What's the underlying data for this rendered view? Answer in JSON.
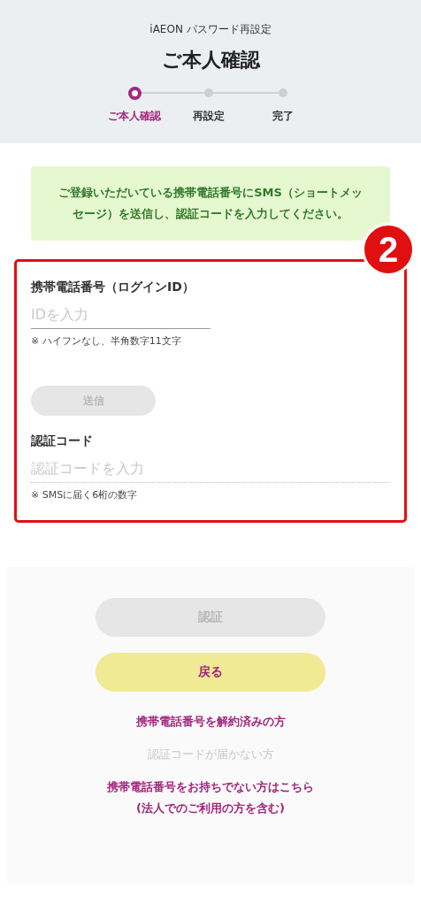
{
  "header": {
    "app_title": "iAEON パスワード再設定",
    "title": "ご本人確認"
  },
  "steps": [
    {
      "label": "ご本人確認",
      "selected": true
    },
    {
      "label": "再設定",
      "selected": false
    },
    {
      "label": "完了",
      "selected": false
    }
  ],
  "notice": "ご登録いただいている携帯電話番号にSMS（ショートメッセージ）を送信し、認証コードを入力してください。",
  "annotation": {
    "number": "2"
  },
  "phone_field": {
    "label": "携帯電話番号（ログインID）",
    "placeholder": "IDを入力",
    "note": "※ ハイフンなし、半角数字11文字"
  },
  "send_button": {
    "label": "送信",
    "disabled": true
  },
  "code_field": {
    "label": "認証コード",
    "placeholder": "認証コードを入力",
    "note": "※ SMSに届く6桁の数字"
  },
  "buttons": [
    {
      "label": "認証",
      "kind": "primary",
      "disabled": true
    },
    {
      "label": "戻る",
      "kind": "back",
      "disabled": false
    }
  ],
  "links": [
    {
      "text": "携帯電話番号を解約済みの方",
      "disabled": false
    },
    {
      "text": "認証コードが届かない方",
      "disabled": true
    },
    {
      "text": "携帯電話番号をお持ちでない方はこちら\n(法人でのご利用の方を含む)",
      "disabled": false
    }
  ]
}
